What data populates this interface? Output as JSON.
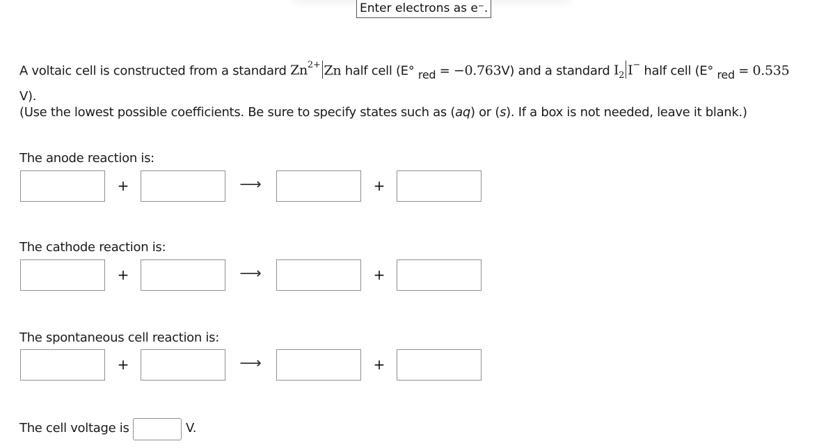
{
  "tooltip": {
    "text": "Enter electrons as e⁻."
  },
  "prompt": {
    "part1": "A voltaic cell is constructed from a standard ",
    "zn_ion": "Zn",
    "zn_charge": "2+",
    "zn_metal": "Zn",
    "part2": " half cell (E° ",
    "red_label": "red",
    "eq": " = ",
    "zn_potential": "−0.763",
    "unit_v": "V",
    "part3": ") and a standard ",
    "i2": "I",
    "i2_sub": "2",
    "i_ion": "I",
    "i_charge": "−",
    "part4": " half cell (E° ",
    "i_potential": "0.535",
    "part5": "V)."
  },
  "instructions": {
    "before_aq": "(Use the lowest possible coefficients. Be sure to specify states such as (",
    "aq": "aq",
    "mid": ") or (",
    "s": "s",
    "after": "). If a box is not needed, leave it blank.)"
  },
  "sections": [
    {
      "label": "The anode reaction is:",
      "inputs": [
        "",
        "",
        "",
        ""
      ]
    },
    {
      "label": "The cathode reaction is:",
      "inputs": [
        "",
        "",
        "",
        ""
      ]
    },
    {
      "label": "The spontaneous cell reaction is:",
      "inputs": [
        "",
        "",
        "",
        ""
      ]
    }
  ],
  "symbols": {
    "plus": "+",
    "arrow": "⟶"
  },
  "voltage": {
    "label": "The cell voltage is",
    "value": "",
    "unit": "V."
  }
}
